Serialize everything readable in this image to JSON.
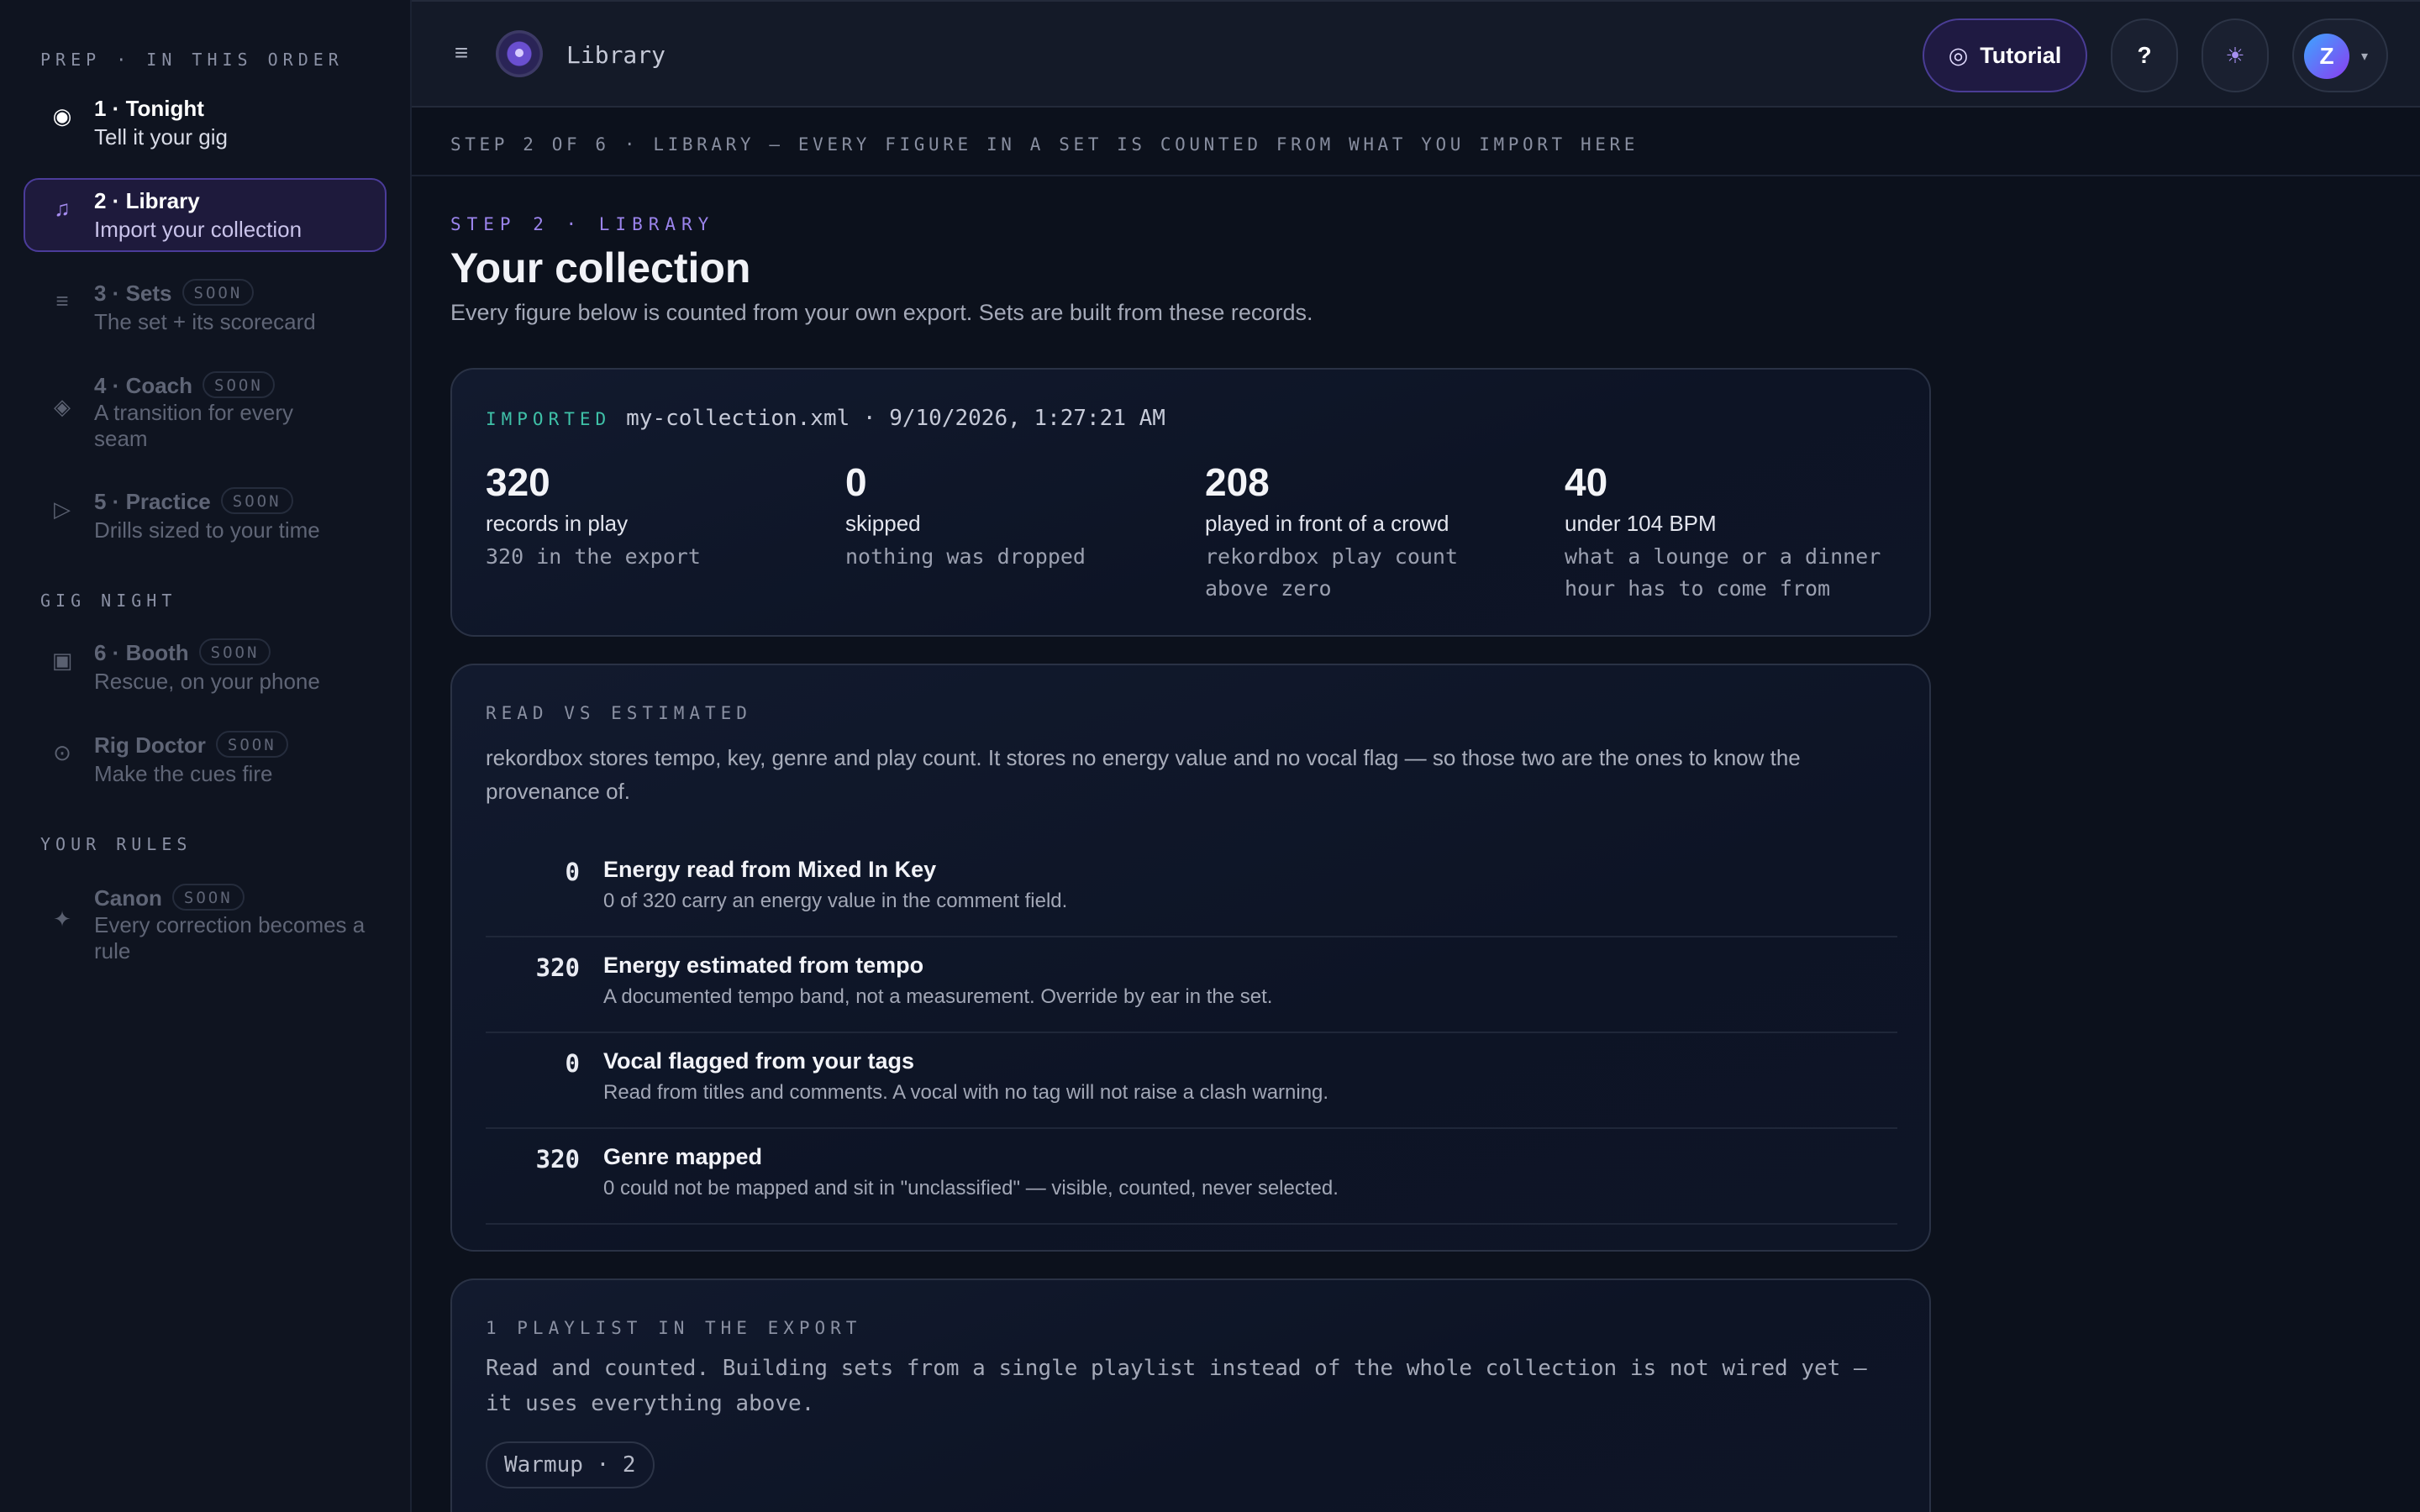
{
  "sidebar": {
    "sections": {
      "prep": "PREP · IN THIS ORDER",
      "gig": "GIG NIGHT",
      "rules": "YOUR RULES"
    },
    "items": [
      {
        "title": "1 · Tonight",
        "sub": "Tell it your gig",
        "icon": "radio-dot-icon",
        "glyph": "◉"
      },
      {
        "title": "2 · Library",
        "sub": "Import your collection",
        "icon": "music-note-icon",
        "glyph": "♫"
      },
      {
        "title": "3 · Sets",
        "sub": "The set + its scorecard",
        "icon": "list-icon",
        "glyph": "≡",
        "badge": "SOON"
      },
      {
        "title": "4 · Coach",
        "sub": "A transition for every seam",
        "sub2": "",
        "icon": "diamond-icon",
        "glyph": "◈",
        "badge": "SOON"
      },
      {
        "title": "5 · Practice",
        "sub": "Drills sized to your time",
        "icon": "play-icon",
        "glyph": "▷",
        "badge": "SOON"
      },
      {
        "title": "6 · Booth",
        "sub": "Rescue, on your phone",
        "icon": "booth-icon",
        "glyph": "▣",
        "badge": "SOON"
      },
      {
        "title": "Rig Doctor",
        "sub": "Make the cues fire",
        "icon": "target-icon",
        "glyph": "⊙",
        "badge": "SOON"
      },
      {
        "title": "Canon",
        "sub": "Every correction becomes a rule",
        "icon": "sparkle-icon",
        "glyph": "✦",
        "badge": "SOON"
      }
    ]
  },
  "topbar": {
    "menu_glyph": "≡",
    "title": "Library",
    "tutorial_icon": "◎",
    "tutorial_label": "Tutorial",
    "help_label": "?",
    "theme_glyph": "☀",
    "avatar_letter": "Z",
    "caret": "▾"
  },
  "stepbar": "STEP 2 OF 6 · LIBRARY — EVERY FIGURE IN A SET IS COUNTED FROM WHAT YOU IMPORT HERE",
  "page": {
    "eyebrow": "STEP 2 · LIBRARY",
    "title": "Your collection",
    "lede": "Every figure below is counted from your own export. Sets are built from these records."
  },
  "import_card": {
    "tag": "IMPORTED",
    "file": "my-collection.xml · 9/10/2026, 1:27:21 AM",
    "stats": [
      {
        "num": "320",
        "label": "records in play",
        "note": "320 in the export"
      },
      {
        "num": "0",
        "label": "skipped",
        "note": "nothing was dropped"
      },
      {
        "num": "208",
        "label": "played in front of a crowd",
        "note": "rekordbox play count above zero"
      },
      {
        "num": "40",
        "label": "under 104 BPM",
        "note": "what a lounge or a dinner hour has to come from"
      }
    ]
  },
  "read_card": {
    "title": "READ VS ESTIMATED",
    "intro": "rekordbox stores tempo, key, genre and play count. It stores no energy value and no vocal flag — so those two are the ones to know the provenance of.",
    "rows": [
      {
        "num": "0",
        "title": "Energy read from Mixed In Key",
        "desc": "0 of 320 carry an energy value in the comment field."
      },
      {
        "num": "320",
        "title": "Energy estimated from tempo",
        "desc": "A documented tempo band, not a measurement. Override by ear in the set."
      },
      {
        "num": "0",
        "title": "Vocal flagged from your tags",
        "desc": "Read from titles and comments. A vocal with no tag will not raise a clash warning."
      },
      {
        "num": "320",
        "title": "Genre mapped",
        "desc": "0 could not be mapped and sit in \"unclassified\" — visible, counted, never selected."
      }
    ]
  },
  "playlist_card": {
    "title": "1 PLAYLIST IN THE EXPORT",
    "desc": "Read and counted. Building sets from a single playlist instead of the whole collection is not wired yet — it uses everything above.",
    "chip": "Warmup · 2"
  }
}
